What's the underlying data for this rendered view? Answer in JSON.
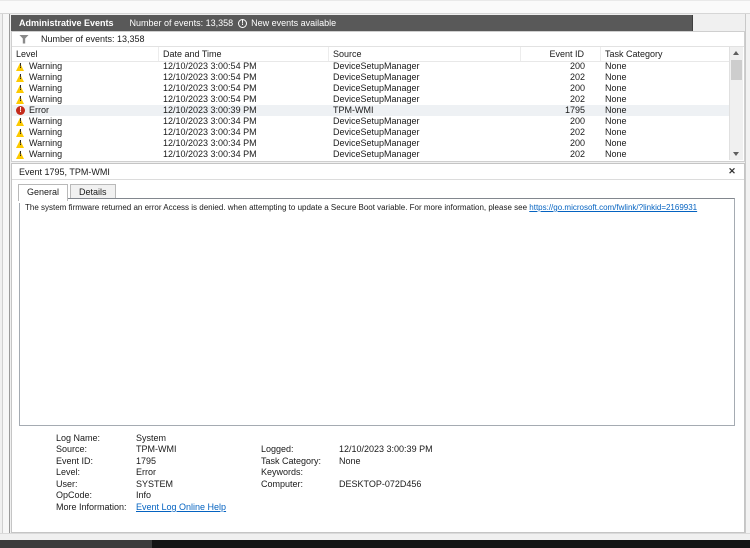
{
  "title_bar": {
    "title": "Administrative Events",
    "events_count": "Number of events: 13,358",
    "new_events_label": "New events available"
  },
  "filter_bar": {
    "events_count": "Number of events: 13,358"
  },
  "table": {
    "columns": [
      "Level",
      "Date and Time",
      "Source",
      "Event ID",
      "Task Category"
    ],
    "rows": [
      {
        "level": "Warning",
        "datetime": "12/10/2023 3:00:54 PM",
        "source": "DeviceSetupManager",
        "event_id": "200",
        "task_category": "None",
        "selected": false
      },
      {
        "level": "Warning",
        "datetime": "12/10/2023 3:00:54 PM",
        "source": "DeviceSetupManager",
        "event_id": "202",
        "task_category": "None",
        "selected": false
      },
      {
        "level": "Warning",
        "datetime": "12/10/2023 3:00:54 PM",
        "source": "DeviceSetupManager",
        "event_id": "200",
        "task_category": "None",
        "selected": false
      },
      {
        "level": "Warning",
        "datetime": "12/10/2023 3:00:54 PM",
        "source": "DeviceSetupManager",
        "event_id": "202",
        "task_category": "None",
        "selected": false
      },
      {
        "level": "Error",
        "datetime": "12/10/2023 3:00:39 PM",
        "source": "TPM-WMI",
        "event_id": "1795",
        "task_category": "None",
        "selected": true
      },
      {
        "level": "Warning",
        "datetime": "12/10/2023 3:00:34 PM",
        "source": "DeviceSetupManager",
        "event_id": "200",
        "task_category": "None",
        "selected": false
      },
      {
        "level": "Warning",
        "datetime": "12/10/2023 3:00:34 PM",
        "source": "DeviceSetupManager",
        "event_id": "202",
        "task_category": "None",
        "selected": false
      },
      {
        "level": "Warning",
        "datetime": "12/10/2023 3:00:34 PM",
        "source": "DeviceSetupManager",
        "event_id": "200",
        "task_category": "None",
        "selected": false
      },
      {
        "level": "Warning",
        "datetime": "12/10/2023 3:00:34 PM",
        "source": "DeviceSetupManager",
        "event_id": "202",
        "task_category": "None",
        "selected": false
      }
    ]
  },
  "event_panel": {
    "header": "Event 1795, TPM-WMI",
    "tabs": [
      {
        "label": "General",
        "active": true
      },
      {
        "label": "Details",
        "active": false
      }
    ],
    "message": "The system firmware returned an error Access is denied. when attempting to update a Secure Boot variable. For more information, please see",
    "message_link": "https://go.microsoft.com/fwlink/?linkid=2169931",
    "details": {
      "log_name_label": "Log Name:",
      "log_name": "System",
      "source_label": "Source:",
      "source": "TPM-WMI",
      "event_id_label": "Event ID:",
      "event_id": "1795",
      "level_label": "Level:",
      "level": "Error",
      "user_label": "User:",
      "user": "SYSTEM",
      "opcode_label": "OpCode:",
      "opcode": "Info",
      "more_info_label": "More Information:",
      "more_info_link": "Event Log Online Help",
      "logged_label": "Logged:",
      "logged": "12/10/2023 3:00:39 PM",
      "task_category_label": "Task Category:",
      "task_category": "None",
      "keywords_label": "Keywords:",
      "keywords": "",
      "computer_label": "Computer:",
      "computer": "DESKTOP-072D456"
    }
  },
  "colors": {
    "titlebar_bg": "#595959",
    "warning_yellow": "#fdca00",
    "error_red": "#c42b1c",
    "link_blue": "#0563c1",
    "selection_bg": "#eef1f4",
    "taskbar_dark": "#141414"
  }
}
